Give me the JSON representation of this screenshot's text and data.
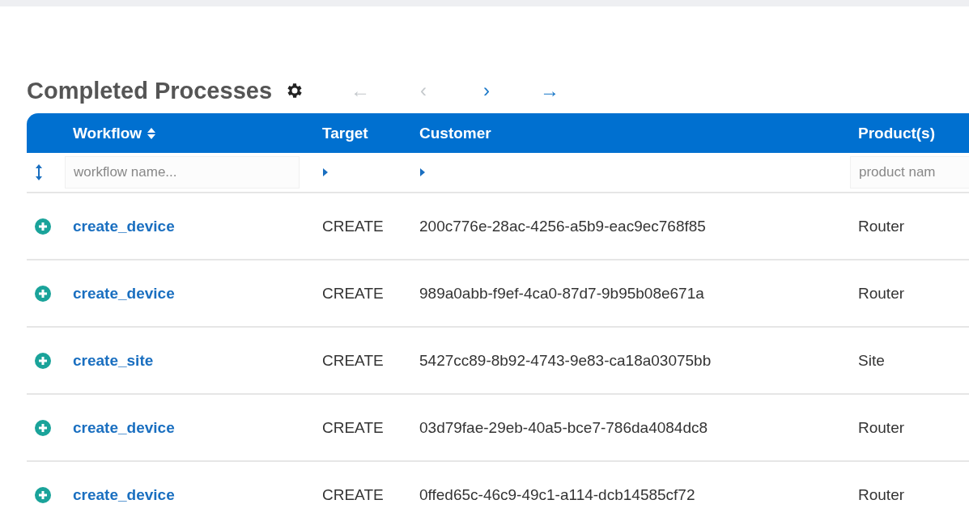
{
  "title": "Completed Processes",
  "nav": [
    {
      "label": "←",
      "disabled": true
    },
    {
      "label": "‹",
      "disabled": true
    },
    {
      "label": "›",
      "disabled": false
    },
    {
      "label": "→",
      "disabled": false
    }
  ],
  "columns": [
    {
      "label": "Workflow",
      "sortable": true
    },
    {
      "label": "Target",
      "sortable": false
    },
    {
      "label": "Customer",
      "sortable": false
    },
    {
      "label": "Product(s)",
      "sortable": false
    }
  ],
  "filters": [
    {
      "kind": "input",
      "placeholder": "workflow name..."
    },
    {
      "kind": "toggle"
    },
    {
      "kind": "toggle"
    },
    {
      "kind": "input",
      "placeholder": "product nam"
    }
  ],
  "rows": [
    {
      "workflow": "create_device",
      "target": "CREATE",
      "customer": "200c776e-28ac-4256-a5b9-eac9ec768f85",
      "product": "Router"
    },
    {
      "workflow": "create_device",
      "target": "CREATE",
      "customer": "989a0abb-f9ef-4ca0-87d7-9b95b08e671a",
      "product": "Router"
    },
    {
      "workflow": "create_site",
      "target": "CREATE",
      "customer": "5427cc89-8b92-4743-9e83-ca18a03075bb",
      "product": "Site"
    },
    {
      "workflow": "create_device",
      "target": "CREATE",
      "customer": "03d79fae-29eb-40a5-bce7-786da4084dc8",
      "product": "Router"
    },
    {
      "workflow": "create_device",
      "target": "CREATE",
      "customer": "0ffed65c-46c9-49c1-a114-dcb14585cf72",
      "product": "Router"
    }
  ]
}
